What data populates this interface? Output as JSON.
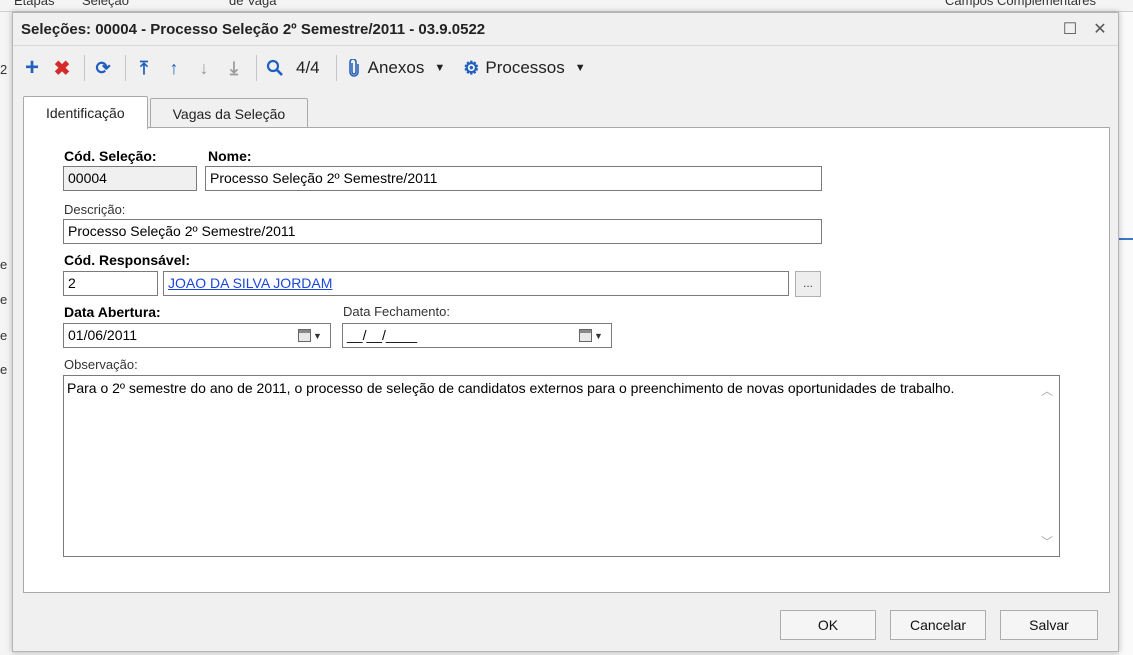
{
  "background": {
    "top_items": [
      "Etapas",
      "Seleção",
      "de Vaga",
      "Campos Complementares"
    ],
    "left_items": [
      "2",
      "e",
      "e",
      "e",
      "e"
    ]
  },
  "dialog": {
    "title": "Seleções: 00004 - Processo Seleção 2º Semestre/2011 - 03.9.0522",
    "maximize_glyph": "☐",
    "close_glyph": "✕"
  },
  "toolbar": {
    "record_counter": "4/4",
    "anexos_label": "Anexos",
    "processos_label": "Processos",
    "icons": {
      "add": "+",
      "delete": "✖",
      "refresh": "⟳",
      "first": "⤒",
      "prev": "↑",
      "next": "↓",
      "last": "⤓",
      "search": "🔍",
      "attach": "📎",
      "gear": "⚙",
      "caret": "▼"
    },
    "colors": {
      "add": "#1f5fbf",
      "delete": "#d42a2a",
      "nav": "#1f5fbf",
      "disabled": "#9a9a9a"
    }
  },
  "tabs": [
    {
      "label": "Identificação",
      "active": true
    },
    {
      "label": "Vagas da Seleção",
      "active": false
    }
  ],
  "form": {
    "cod_selecao_label": "Cód. Seleção:",
    "cod_selecao_value": "00004",
    "nome_label": "Nome:",
    "nome_value": "Processo Seleção 2º Semestre/2011",
    "descricao_label": "Descrição:",
    "descricao_value": "Processo Seleção 2º Semestre/2011",
    "responsavel_label": "Cód. Responsável:",
    "responsavel_code": "2",
    "responsavel_name": "JOAO DA SILVA JORDAM",
    "lookup_button": "...",
    "data_abertura_label": "Data Abertura:",
    "data_abertura_value": "01/06/2011",
    "data_fechamento_label": "Data Fechamento:",
    "data_fechamento_value": "__/__/____",
    "observacao_label": "Observação:",
    "observacao_value": "Para o 2º semestre do ano de 2011, o processo de seleção de candidatos externos para o preenchimento de novas oportunidades de trabalho."
  },
  "footer": {
    "ok": "OK",
    "cancel": "Cancelar",
    "save": "Salvar"
  }
}
